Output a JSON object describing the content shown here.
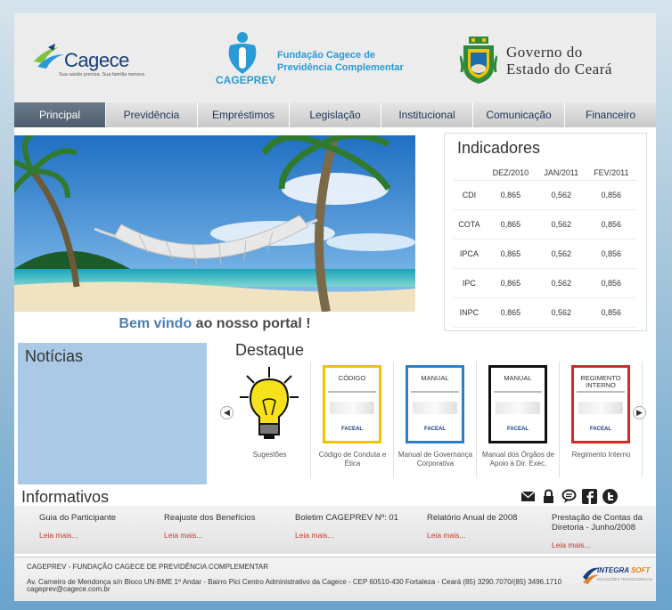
{
  "header": {
    "cagece": {
      "name": "Cagece",
      "tagline": "Sua saúde precisa. Sua família merece."
    },
    "cageprev": {
      "acronym": "CAGEPREV",
      "foundation_line1": "Fundação Cagece de",
      "foundation_line2": "Previdência  Complementar"
    },
    "government": {
      "line1": "Governo do",
      "line2": "Estado do Ceará"
    }
  },
  "nav": {
    "items": [
      {
        "label": "Principal"
      },
      {
        "label": "Previdência"
      },
      {
        "label": "Empréstimos"
      },
      {
        "label": "Legislação"
      },
      {
        "label": "Institucional"
      },
      {
        "label": "Comunicação"
      },
      {
        "label": "Financeiro"
      }
    ],
    "active_color": "#5b6b7b"
  },
  "hero": {
    "welcome_part1": "Bem vindo",
    "welcome_part2": "ao nosso portal !"
  },
  "indicators": {
    "title": "Indicadores",
    "columns": [
      "DEZ/2010",
      "JAN/2011",
      "FEV/2011"
    ],
    "rows": [
      {
        "name": "CDI",
        "values": [
          "0,865",
          "0,562",
          "0,856"
        ]
      },
      {
        "name": "COTA",
        "values": [
          "0,865",
          "0,562",
          "0,856"
        ]
      },
      {
        "name": "IPCA",
        "values": [
          "0,865",
          "0,562",
          "0,856"
        ]
      },
      {
        "name": "IPC",
        "values": [
          "0,865",
          "0,562",
          "0,856"
        ]
      },
      {
        "name": "INPC",
        "values": [
          "0,865",
          "0,562",
          "0,856"
        ]
      }
    ]
  },
  "news": {
    "title": "Notícias"
  },
  "featured": {
    "title": "Destaque",
    "items": [
      {
        "caption": "Sugestões",
        "icon": "lightbulb-icon"
      },
      {
        "caption": "Código de Conduta e Ética",
        "book_title": "CÓDIGO",
        "book_color": "#f2c200",
        "logo": "FACEAL"
      },
      {
        "caption": "Manual de Governança Corporativa",
        "book_title": "MANUAL",
        "book_color": "#2a7fc6",
        "logo": "FACEAL"
      },
      {
        "caption": "Manual dos Órgãos de Apoio à Dir. Exec.",
        "book_title": "MANUAL",
        "book_color": "#111111",
        "logo": "FACEAL"
      },
      {
        "caption": "Regimento Interno",
        "book_title": "REGIMENTO INTERNO",
        "book_color": "#d62828",
        "logo": "FACEAL"
      }
    ]
  },
  "newsletter": {
    "title": "Informativos",
    "items": [
      {
        "title": "Guia do Participante",
        "more": "Leia mais..."
      },
      {
        "title": "Reajuste dos Benefícios",
        "more": "Leia mais..."
      },
      {
        "title": "Boletim CAGEPREV Nº: 01",
        "more": "Leia mais..."
      },
      {
        "title": "Relatório Anual de 2008",
        "more": "Leia mais..."
      },
      {
        "title": "Prestação de Contas da Diretoria - Junho/2008",
        "more": "Leia mais..."
      }
    ],
    "social_icons": [
      "mail-icon",
      "lock-icon",
      "chat-icon",
      "facebook-icon",
      "twitter-icon"
    ]
  },
  "footer": {
    "org": "CAGEPREV - FUNDAÇÃO CAGECE DE PREVIDÊNCIA COMPLEMENTAR",
    "address": "Av. Carneiro de Mendonça s/n  Bloco UN-BME 1º Andar - Bairro Pici   Centro Administrativo da Cagece - CEP 60510-430   Fortaleza - Ceará  (85) 3290.7070/(85) 3496.1710",
    "email": "cageprev@cagece.com.br",
    "developer_a": "INTEGRA",
    "developer_b": "SOFT",
    "developer_tag": "SOLUÇÕES TECNOLÓGICAS"
  }
}
